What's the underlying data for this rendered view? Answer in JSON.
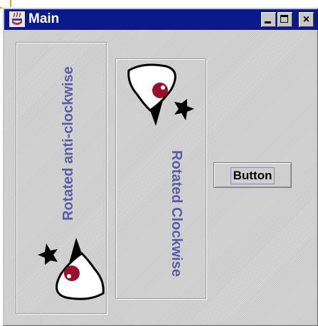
{
  "window": {
    "title": "Main",
    "title_bar_color": "#0a1a8c",
    "controls": [
      {
        "name": "minimize",
        "icon": "minimize-icon"
      },
      {
        "name": "maximize",
        "icon": "maximize-icon"
      },
      {
        "name": "close",
        "icon": "close-icon",
        "label": "×"
      }
    ]
  },
  "panels": {
    "left": {
      "label": "Rotated anti-clockwise",
      "icon": "duke-mascot-icon"
    },
    "right": {
      "label": "Rotated Clockwise",
      "icon": "duke-mascot-icon"
    }
  },
  "button": {
    "label": "Button"
  },
  "colors": {
    "label_text": "#5c5ca8",
    "background": "#cfcfcf"
  }
}
